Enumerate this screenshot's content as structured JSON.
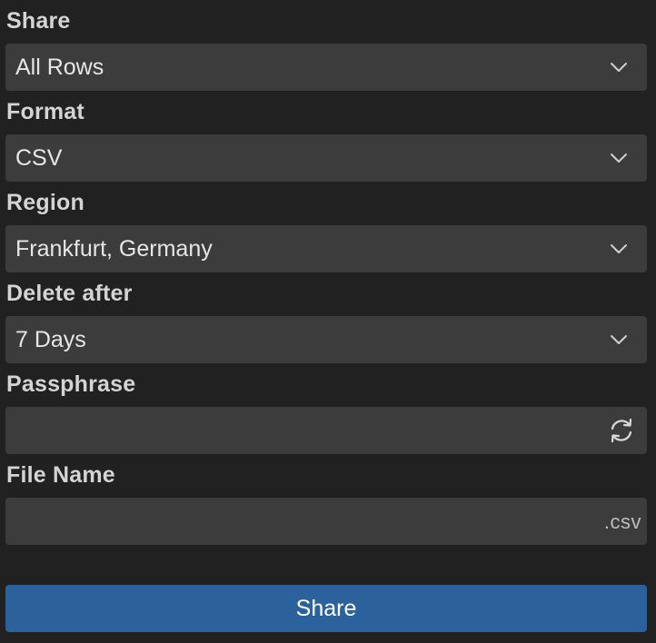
{
  "form": {
    "share": {
      "label": "Share",
      "value": "All Rows"
    },
    "format": {
      "label": "Format",
      "value": "CSV"
    },
    "region": {
      "label": "Region",
      "value": "Frankfurt, Germany"
    },
    "delete_after": {
      "label": "Delete after",
      "value": "7 Days"
    },
    "passphrase": {
      "label": "Passphrase",
      "value": "",
      "action_icon": "refresh-icon"
    },
    "file_name": {
      "label": "File Name",
      "value": "",
      "suffix": ".csv"
    },
    "submit_label": "Share"
  },
  "colors": {
    "background": "#212121",
    "field": "#3c3c3c",
    "button": "#2c629b",
    "text": "#d6d6d6"
  }
}
